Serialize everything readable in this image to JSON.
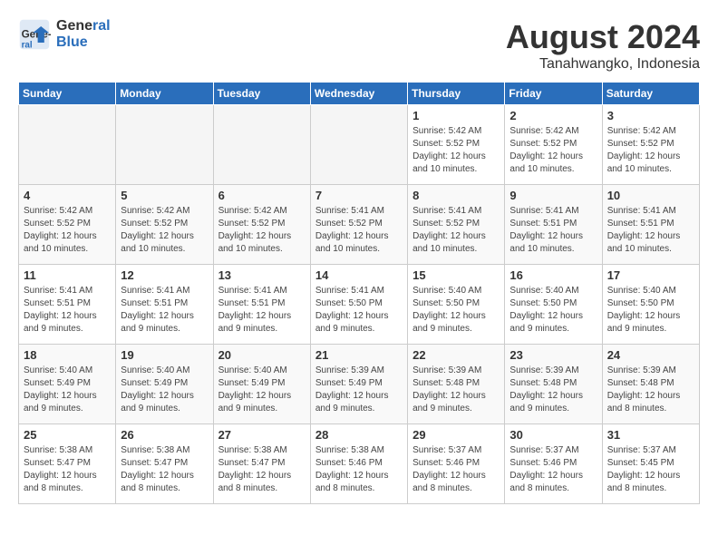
{
  "header": {
    "logo_line1": "General",
    "logo_line2": "Blue",
    "month_year": "August 2024",
    "location": "Tanahwangko, Indonesia"
  },
  "weekdays": [
    "Sunday",
    "Monday",
    "Tuesday",
    "Wednesday",
    "Thursday",
    "Friday",
    "Saturday"
  ],
  "weeks": [
    [
      {
        "day": "",
        "info": ""
      },
      {
        "day": "",
        "info": ""
      },
      {
        "day": "",
        "info": ""
      },
      {
        "day": "",
        "info": ""
      },
      {
        "day": "1",
        "info": "Sunrise: 5:42 AM\nSunset: 5:52 PM\nDaylight: 12 hours\nand 10 minutes."
      },
      {
        "day": "2",
        "info": "Sunrise: 5:42 AM\nSunset: 5:52 PM\nDaylight: 12 hours\nand 10 minutes."
      },
      {
        "day": "3",
        "info": "Sunrise: 5:42 AM\nSunset: 5:52 PM\nDaylight: 12 hours\nand 10 minutes."
      }
    ],
    [
      {
        "day": "4",
        "info": "Sunrise: 5:42 AM\nSunset: 5:52 PM\nDaylight: 12 hours\nand 10 minutes."
      },
      {
        "day": "5",
        "info": "Sunrise: 5:42 AM\nSunset: 5:52 PM\nDaylight: 12 hours\nand 10 minutes."
      },
      {
        "day": "6",
        "info": "Sunrise: 5:42 AM\nSunset: 5:52 PM\nDaylight: 12 hours\nand 10 minutes."
      },
      {
        "day": "7",
        "info": "Sunrise: 5:41 AM\nSunset: 5:52 PM\nDaylight: 12 hours\nand 10 minutes."
      },
      {
        "day": "8",
        "info": "Sunrise: 5:41 AM\nSunset: 5:52 PM\nDaylight: 12 hours\nand 10 minutes."
      },
      {
        "day": "9",
        "info": "Sunrise: 5:41 AM\nSunset: 5:51 PM\nDaylight: 12 hours\nand 10 minutes."
      },
      {
        "day": "10",
        "info": "Sunrise: 5:41 AM\nSunset: 5:51 PM\nDaylight: 12 hours\nand 10 minutes."
      }
    ],
    [
      {
        "day": "11",
        "info": "Sunrise: 5:41 AM\nSunset: 5:51 PM\nDaylight: 12 hours\nand 9 minutes."
      },
      {
        "day": "12",
        "info": "Sunrise: 5:41 AM\nSunset: 5:51 PM\nDaylight: 12 hours\nand 9 minutes."
      },
      {
        "day": "13",
        "info": "Sunrise: 5:41 AM\nSunset: 5:51 PM\nDaylight: 12 hours\nand 9 minutes."
      },
      {
        "day": "14",
        "info": "Sunrise: 5:41 AM\nSunset: 5:50 PM\nDaylight: 12 hours\nand 9 minutes."
      },
      {
        "day": "15",
        "info": "Sunrise: 5:40 AM\nSunset: 5:50 PM\nDaylight: 12 hours\nand 9 minutes."
      },
      {
        "day": "16",
        "info": "Sunrise: 5:40 AM\nSunset: 5:50 PM\nDaylight: 12 hours\nand 9 minutes."
      },
      {
        "day": "17",
        "info": "Sunrise: 5:40 AM\nSunset: 5:50 PM\nDaylight: 12 hours\nand 9 minutes."
      }
    ],
    [
      {
        "day": "18",
        "info": "Sunrise: 5:40 AM\nSunset: 5:49 PM\nDaylight: 12 hours\nand 9 minutes."
      },
      {
        "day": "19",
        "info": "Sunrise: 5:40 AM\nSunset: 5:49 PM\nDaylight: 12 hours\nand 9 minutes."
      },
      {
        "day": "20",
        "info": "Sunrise: 5:40 AM\nSunset: 5:49 PM\nDaylight: 12 hours\nand 9 minutes."
      },
      {
        "day": "21",
        "info": "Sunrise: 5:39 AM\nSunset: 5:49 PM\nDaylight: 12 hours\nand 9 minutes."
      },
      {
        "day": "22",
        "info": "Sunrise: 5:39 AM\nSunset: 5:48 PM\nDaylight: 12 hours\nand 9 minutes."
      },
      {
        "day": "23",
        "info": "Sunrise: 5:39 AM\nSunset: 5:48 PM\nDaylight: 12 hours\nand 9 minutes."
      },
      {
        "day": "24",
        "info": "Sunrise: 5:39 AM\nSunset: 5:48 PM\nDaylight: 12 hours\nand 8 minutes."
      }
    ],
    [
      {
        "day": "25",
        "info": "Sunrise: 5:38 AM\nSunset: 5:47 PM\nDaylight: 12 hours\nand 8 minutes."
      },
      {
        "day": "26",
        "info": "Sunrise: 5:38 AM\nSunset: 5:47 PM\nDaylight: 12 hours\nand 8 minutes."
      },
      {
        "day": "27",
        "info": "Sunrise: 5:38 AM\nSunset: 5:47 PM\nDaylight: 12 hours\nand 8 minutes."
      },
      {
        "day": "28",
        "info": "Sunrise: 5:38 AM\nSunset: 5:46 PM\nDaylight: 12 hours\nand 8 minutes."
      },
      {
        "day": "29",
        "info": "Sunrise: 5:37 AM\nSunset: 5:46 PM\nDaylight: 12 hours\nand 8 minutes."
      },
      {
        "day": "30",
        "info": "Sunrise: 5:37 AM\nSunset: 5:46 PM\nDaylight: 12 hours\nand 8 minutes."
      },
      {
        "day": "31",
        "info": "Sunrise: 5:37 AM\nSunset: 5:45 PM\nDaylight: 12 hours\nand 8 minutes."
      }
    ]
  ]
}
